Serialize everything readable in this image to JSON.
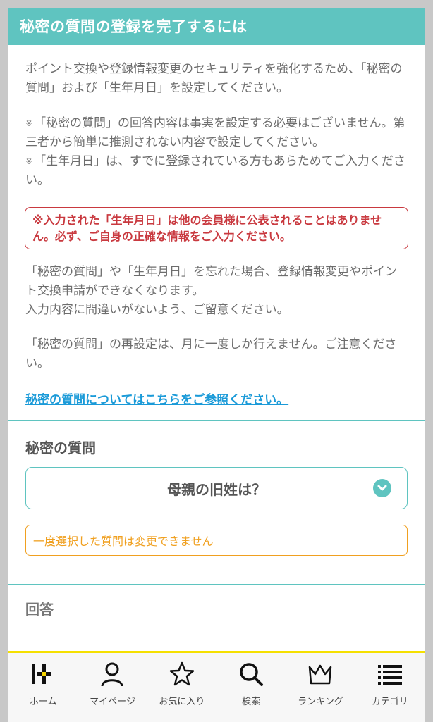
{
  "header": {
    "title": "秘密の質問の登録を完了するには"
  },
  "intro": "ポイント交換や登録情報変更のセキュリティを強化するため、「秘密の質問」および「生年月日」を設定してください。",
  "notes": [
    {
      "mark": "※",
      "text": "「秘密の質問」の回答内容は事実を設定する必要はございません。第三者から簡単に推測されない内容で設定してください。"
    },
    {
      "mark": "※",
      "text": "「生年月日」は、すでに登録されている方もあらためてご入力ください。"
    }
  ],
  "warning": "※入力された「生年月日」は他の会員様に公表されることはありません。必ず、ご自身の正確な情報をご入力ください。",
  "forget_text_1": "「秘密の質問」や「生年月日」を忘れた場合、登録情報変更やポイント交換申請ができなくなります。",
  "forget_text_2": "入力内容に間違いがないよう、ご留意ください。",
  "reset_text": "「秘密の質問」の再設定は、月に一度しか行えません。ご注意ください。",
  "help_link": "秘密の質問についてはこちらをご参照ください。",
  "question": {
    "label": "秘密の質問",
    "selected": "母親の旧姓は？",
    "notice": "一度選択した質問は変更できません"
  },
  "answer": {
    "label": "回答"
  },
  "colors": {
    "accent": "#5fc4c0",
    "warning": "#c9393f",
    "notice": "#f0a020",
    "link": "#1a9ad8",
    "tab_border": "#f5e000"
  },
  "tabs": [
    {
      "label": "ホーム",
      "icon": "home-logo-icon"
    },
    {
      "label": "マイページ",
      "icon": "person-icon"
    },
    {
      "label": "お気に入り",
      "icon": "star-icon"
    },
    {
      "label": "検索",
      "icon": "search-icon"
    },
    {
      "label": "ランキング",
      "icon": "crown-icon"
    },
    {
      "label": "カテゴリ",
      "icon": "list-icon"
    }
  ]
}
